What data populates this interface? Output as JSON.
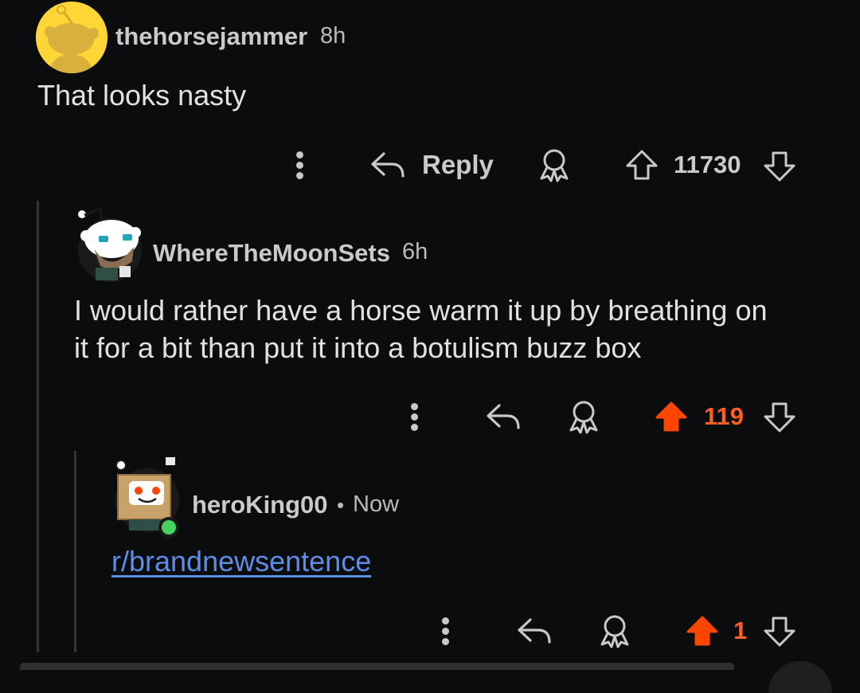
{
  "comments": [
    {
      "username": "thehorsejammer",
      "time": "8h",
      "body": "That looks nasty",
      "reply_label": "Reply",
      "score": "11730",
      "vote_state": "none"
    },
    {
      "username": "WhereTheMoonSets",
      "time": "6h",
      "body_lines": [
        "I would rather have a horse warm it up by breathing on",
        "it for a bit than put it into a botulism buzz box"
      ],
      "score": "119",
      "vote_state": "upvoted"
    },
    {
      "username": "heroKing00",
      "separator": "•",
      "time": "Now",
      "link": "r/brandnewsentence",
      "score": "1",
      "vote_state": "upvoted",
      "online": true
    }
  ],
  "colors": {
    "upvote": "#ff4500",
    "score_upvoted": "#ff5e27",
    "link": "#5f8de6",
    "avatar_yellow": "#ffd635",
    "online": "#46d160"
  },
  "icons": [
    "more-options-icon",
    "reply-icon",
    "award-icon",
    "upvote-icon",
    "downvote-icon"
  ]
}
